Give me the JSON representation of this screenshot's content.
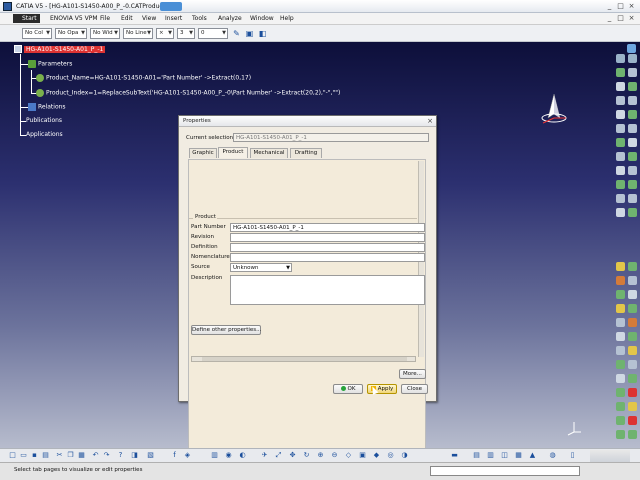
{
  "window": {
    "title": "CATIA V5 - [HG-A101-S1450-A00_P_-0.CATProduct]",
    "controls": [
      "_",
      "□",
      "×"
    ]
  },
  "menubar": {
    "items": [
      "Start",
      "ENOVIA V5 VPM",
      "File",
      "Edit",
      "View",
      "Insert",
      "Tools",
      "Analyze",
      "Window",
      "Help"
    ]
  },
  "toolbar": {
    "color_select": "No Col",
    "opacity_select": "No Opa",
    "width_select": "No Wid",
    "linetype_select": "No Line",
    "layer_value": "3",
    "point_value": "0"
  },
  "tree": {
    "root": "HG-A101-S1450-A01_P_-1",
    "parameters": "Parameters",
    "param1": "Product_Name=HG-A101-S1450-A01='Part Number' ->Extract(0,17)",
    "param2": "Product_Index=1=ReplaceSubText('HG-A101-S1450-A00_P_-0\\Part Number' ->Extract(20,2),\"-\",\"\")",
    "relations": "Relations",
    "publications": "Publications",
    "applications": "Applications"
  },
  "dialog": {
    "title": "Properties",
    "current_selection_label": "Current selection :",
    "current_selection_value": "HG-A101-S1450-A01_P_-1",
    "tabs": [
      "Graphic",
      "Product",
      "Mechanical",
      "Drafting"
    ],
    "active_tab": "Product",
    "group_label": "Product",
    "part_number_label": "Part Number",
    "part_number_value": "HG-A101-S1450-A01_P_-1",
    "revision_label": "Revision",
    "revision_value": "",
    "definition_label": "Definition",
    "definition_value": "",
    "nomenclature_label": "Nomenclature",
    "nomenclature_value": "",
    "source_label": "Source",
    "source_value": "Unknown",
    "description_label": "Description",
    "description_value": "",
    "define_other_label": "Define other properties...",
    "more_label": "More...",
    "ok_label": "OK",
    "apply_label": "Apply",
    "close_label": "Close"
  },
  "status": {
    "text": "Select tab pages to visualize or edit properties"
  },
  "colors": {
    "background_top": "#0d0f3a",
    "background_bottom": "#b7bccd",
    "tree_highlight": "#d33333",
    "dialog_bg": "#f1ece2"
  }
}
